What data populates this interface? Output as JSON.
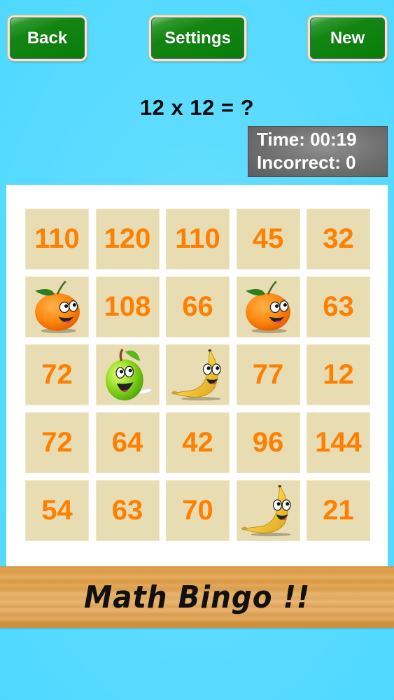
{
  "toolbar": {
    "back_label": "Back",
    "settings_label": "Settings",
    "new_label": "New"
  },
  "question": {
    "text": "12 x 12 = ?"
  },
  "stats": {
    "time": "Time: 00:19",
    "incorrect": "Incorrect: 0"
  },
  "board": {
    "rows": [
      [
        {
          "value": "110"
        },
        {
          "value": "120"
        },
        {
          "value": "110"
        },
        {
          "value": "45"
        },
        {
          "value": "32"
        }
      ],
      [
        {
          "marker": "orange"
        },
        {
          "value": "108"
        },
        {
          "value": "66"
        },
        {
          "marker": "orange"
        },
        {
          "value": "63"
        }
      ],
      [
        {
          "value": "72"
        },
        {
          "marker": "apple"
        },
        {
          "marker": "banana"
        },
        {
          "value": "77"
        },
        {
          "value": "12"
        }
      ],
      [
        {
          "value": "72"
        },
        {
          "value": "64"
        },
        {
          "value": "42"
        },
        {
          "value": "96"
        },
        {
          "value": "144"
        }
      ],
      [
        {
          "value": "54"
        },
        {
          "value": "63"
        },
        {
          "value": "70"
        },
        {
          "marker": "banana"
        },
        {
          "value": "21"
        }
      ]
    ]
  },
  "banner": {
    "title": "Math Bingo !!"
  },
  "colors": {
    "button_green": "#087d08",
    "number_orange": "#ff7f00",
    "cell_tan": "#e8dcb2",
    "background_blue": "#4fd8ff"
  }
}
